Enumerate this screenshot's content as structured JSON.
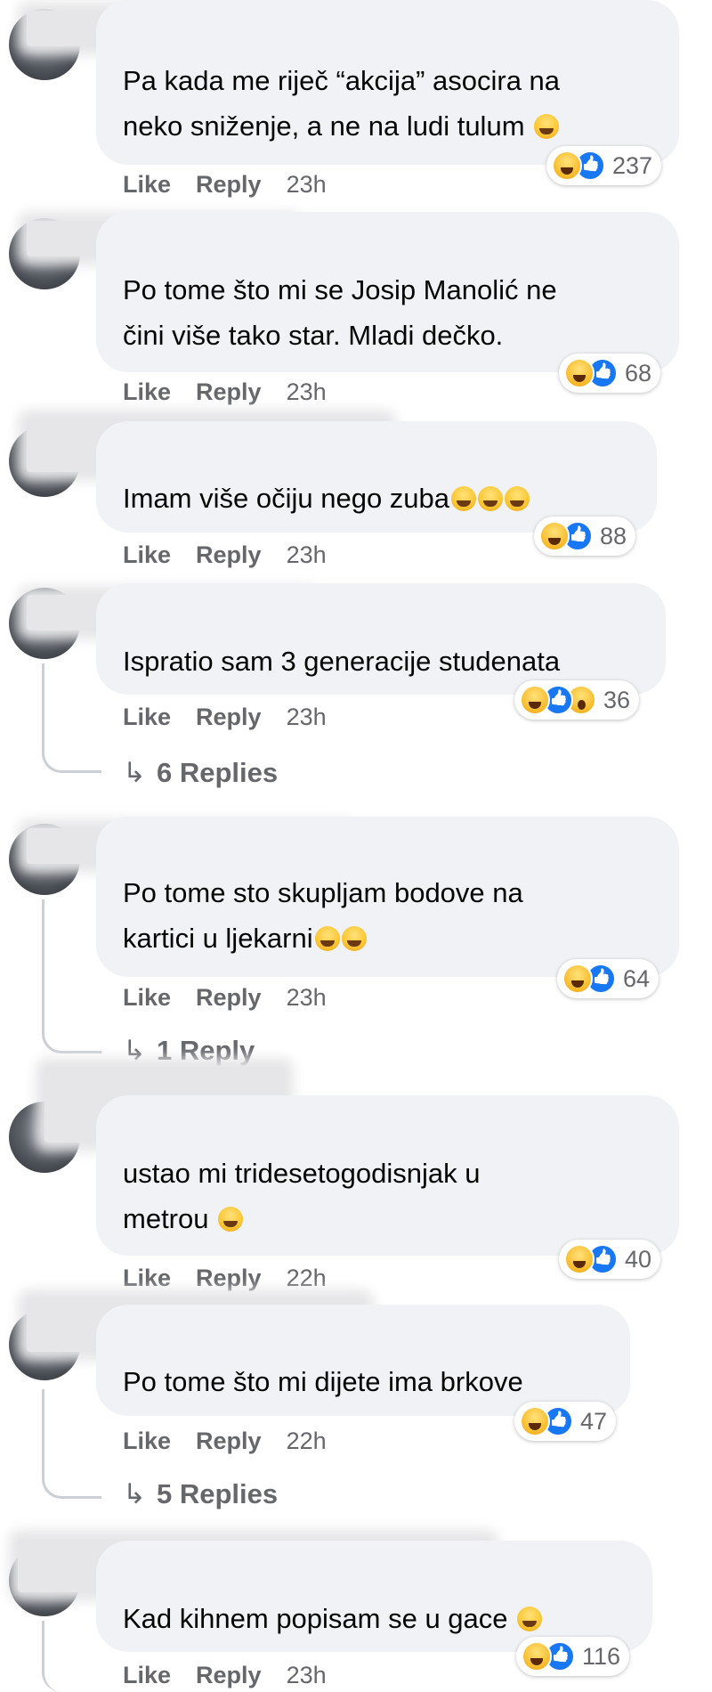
{
  "comments": [
    {
      "text": "Pa kada me riječ “akcija” asocira na\nneko sniženje, a ne na ludi tulum",
      "reactions": [
        "haha",
        "like"
      ],
      "count": "237",
      "like": "Like",
      "reply": "Reply",
      "time": "23h"
    },
    {
      "text": "Po tome što mi se Josip Manolić ne\nčini više tako star. Mladi dečko.",
      "reactions": [
        "haha",
        "like"
      ],
      "count": "68",
      "like": "Like",
      "reply": "Reply",
      "time": "23h"
    },
    {
      "text": "Imam više očiju nego zuba",
      "reactions": [
        "haha",
        "like"
      ],
      "count": "88",
      "like": "Like",
      "reply": "Reply",
      "time": "23h"
    },
    {
      "text": "Ispratio sam 3 generacije studenata",
      "reactions": [
        "haha",
        "like",
        "wow"
      ],
      "count": "36",
      "like": "Like",
      "reply": "Reply",
      "time": "23h",
      "replies": "6 Replies"
    },
    {
      "text": "Po tome sto skupljam bodove na\nkartici u ljekarni",
      "reactions": [
        "haha",
        "like"
      ],
      "count": "64",
      "like": "Like",
      "reply": "Reply",
      "time": "23h",
      "replies": "1 Reply"
    },
    {
      "text": "ustao mi tridesetogodisnjak u\nmetrou",
      "reactions": [
        "haha",
        "like"
      ],
      "count": "40",
      "like": "Like",
      "reply": "Reply",
      "time": "22h"
    },
    {
      "text": "Po tome što mi dijete ima brkove",
      "reactions": [
        "haha",
        "like"
      ],
      "count": "47",
      "like": "Like",
      "reply": "Reply",
      "time": "22h",
      "replies": "5 Replies"
    },
    {
      "text": "Kad kihnem popisam se u gace",
      "reactions": [
        "haha",
        "like"
      ],
      "count": "116",
      "like": "Like",
      "reply": "Reply",
      "time": "23h"
    }
  ],
  "emoji_names": [
    "grinning-emoji",
    "wink-emoji",
    "joy-emoji",
    "facepalm-emoji",
    "smile-emoji"
  ],
  "colors": {
    "bubble": "#f0f2f5",
    "meta": "#65676b",
    "like_blue": "#1877f2",
    "haha_yellow": "#f7b928"
  }
}
